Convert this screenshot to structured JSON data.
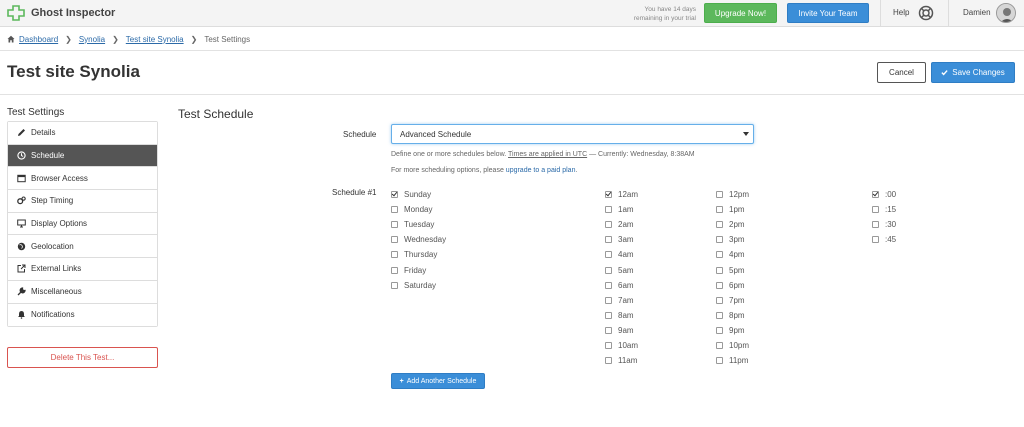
{
  "app": {
    "brand": "Ghost Inspector",
    "accent": "#3b8ed8",
    "success": "#5cb85c",
    "danger": "#d9534f"
  },
  "topbar": {
    "trial_line1": "You have 14 days",
    "trial_line2": "remaining in your trial",
    "upgrade_label": "Upgrade Now!",
    "invite_label": "Invite Your Team",
    "help_label": "Help",
    "user_name": "Damien"
  },
  "breadcrumb": {
    "items": [
      "Dashboard",
      "Synolia",
      "Test site Synolia"
    ],
    "current": "Test Settings"
  },
  "header": {
    "title": "Test site Synolia",
    "cancel_label": "Cancel",
    "save_label": "Save Changes"
  },
  "sidebar": {
    "heading": "Test Settings",
    "items": [
      {
        "label": "Details",
        "icon": "pencil-icon"
      },
      {
        "label": "Schedule",
        "icon": "clock-icon"
      },
      {
        "label": "Browser Access",
        "icon": "window-icon"
      },
      {
        "label": "Step Timing",
        "icon": "cogs-icon"
      },
      {
        "label": "Display Options",
        "icon": "monitor-icon"
      },
      {
        "label": "Geolocation",
        "icon": "globe-icon"
      },
      {
        "label": "External Links",
        "icon": "external-link-icon"
      },
      {
        "label": "Miscellaneous",
        "icon": "wrench-icon"
      },
      {
        "label": "Notifications",
        "icon": "bell-icon"
      }
    ],
    "active": "Schedule",
    "delete_label": "Delete This Test..."
  },
  "main": {
    "section_title": "Test Schedule",
    "schedule_label": "Schedule",
    "schedule_value": "Advanced Schedule",
    "help_prefix": "Define one or more schedules below.",
    "help_link": "Times are applied in UTC",
    "help_suffix": "— Currently: Wednesday, 8:38AM",
    "upgrade_prefix": "For more scheduling options, please",
    "upgrade_link": "upgrade to a paid plan",
    "upgrade_suffix": ".",
    "schedule_row_label": "Schedule #1",
    "days": [
      {
        "label": "Sunday",
        "checked": true
      },
      {
        "label": "Monday",
        "checked": false
      },
      {
        "label": "Tuesday",
        "checked": false
      },
      {
        "label": "Wednesday",
        "checked": false
      },
      {
        "label": "Thursday",
        "checked": false
      },
      {
        "label": "Friday",
        "checked": false
      },
      {
        "label": "Saturday",
        "checked": false
      }
    ],
    "hours_am": [
      {
        "label": "12am",
        "checked": true
      },
      {
        "label": "1am",
        "checked": false
      },
      {
        "label": "2am",
        "checked": false
      },
      {
        "label": "3am",
        "checked": false
      },
      {
        "label": "4am",
        "checked": false
      },
      {
        "label": "5am",
        "checked": false
      },
      {
        "label": "6am",
        "checked": false
      },
      {
        "label": "7am",
        "checked": false
      },
      {
        "label": "8am",
        "checked": false
      },
      {
        "label": "9am",
        "checked": false
      },
      {
        "label": "10am",
        "checked": false
      },
      {
        "label": "11am",
        "checked": false
      }
    ],
    "hours_pm": [
      {
        "label": "12pm",
        "checked": false
      },
      {
        "label": "1pm",
        "checked": false
      },
      {
        "label": "2pm",
        "checked": false
      },
      {
        "label": "3pm",
        "checked": false
      },
      {
        "label": "4pm",
        "checked": false
      },
      {
        "label": "5pm",
        "checked": false
      },
      {
        "label": "6pm",
        "checked": false
      },
      {
        "label": "7pm",
        "checked": false
      },
      {
        "label": "8pm",
        "checked": false
      },
      {
        "label": "9pm",
        "checked": false
      },
      {
        "label": "10pm",
        "checked": false
      },
      {
        "label": "11pm",
        "checked": false
      }
    ],
    "minutes": [
      {
        "label": ":00",
        "checked": true
      },
      {
        "label": ":15",
        "checked": false
      },
      {
        "label": ":30",
        "checked": false
      },
      {
        "label": ":45",
        "checked": false
      }
    ],
    "add_schedule_label": "Add Another Schedule"
  }
}
